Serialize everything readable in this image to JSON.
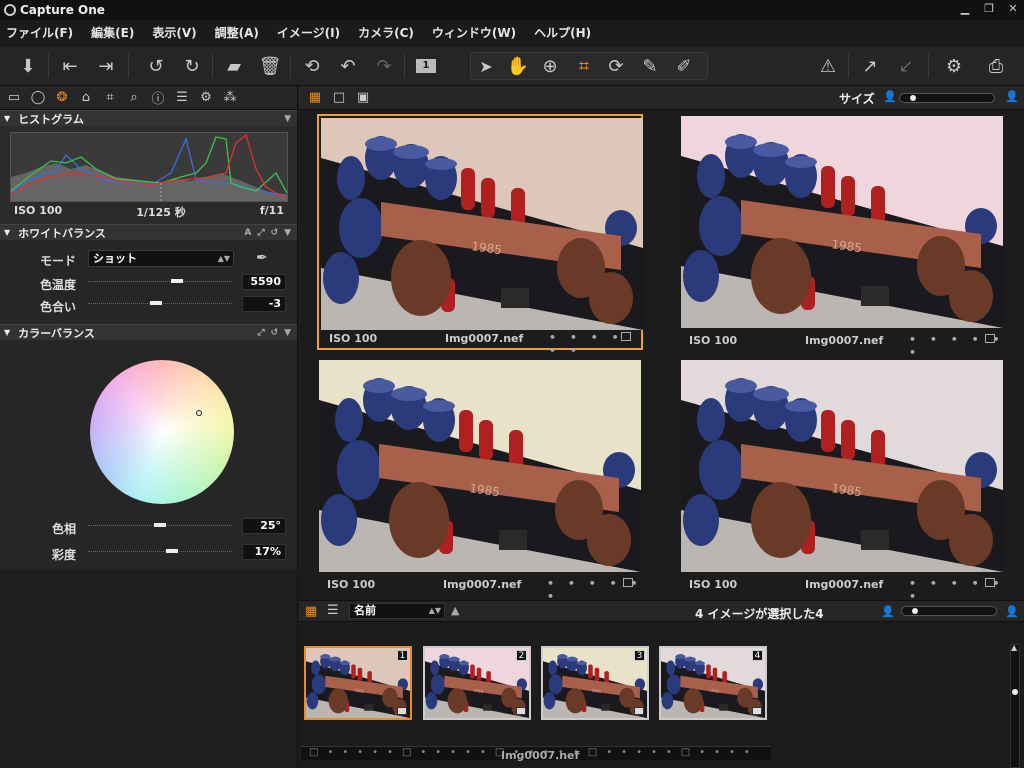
{
  "app": {
    "title": "Capture One"
  },
  "menu": [
    "ファイル(F)",
    "編集(E)",
    "表示(V)",
    "調整(A)",
    "イメージ(I)",
    "カメラ(C)",
    "ウィンドウ(W)",
    "ヘルプ(H)"
  ],
  "toolbar": {
    "badge": "1"
  },
  "histogram": {
    "title": "ヒストグラム",
    "iso": "ISO 100",
    "shutter": "1/125 秒",
    "aperture": "f/11"
  },
  "white_balance": {
    "title": "ホワイトバランス",
    "mode_label": "モード",
    "mode_value": "ショット",
    "temp_label": "色温度",
    "temp_value": "5590",
    "tint_label": "色合い",
    "tint_value": "-3",
    "temp_level": 0.62,
    "tint_level": 0.47
  },
  "color_balance": {
    "title": "カラーバランス",
    "hue_label": "色相",
    "hue_value": "25°",
    "sat_label": "彩度",
    "sat_value": "17%",
    "hue_level": 0.5,
    "sat_level": 0.58
  },
  "viewer": {
    "size_label": "サイズ"
  },
  "thumbs": [
    {
      "iso": "ISO 100",
      "name": "Img0007.nef",
      "dots": "• • • • • •"
    },
    {
      "iso": "ISO 100",
      "name": "Img0007.nef",
      "dots": "• • • • • •"
    },
    {
      "iso": "ISO 100",
      "name": "Img0007.nef",
      "dots": "• • • • • •"
    },
    {
      "iso": "ISO 100",
      "name": "Img0007.nef",
      "dots": "• • • • • •"
    }
  ],
  "browser": {
    "sort_value": "名前",
    "count_text": "4 イメージが選択した4"
  },
  "filmstrip": {
    "items": [
      "1",
      "2",
      "3",
      "4"
    ],
    "bottom_name": "Img0007.nef"
  },
  "colors": {
    "accent": "#f08c1e",
    "panel": "#262626",
    "background": "#1c1c1c"
  }
}
